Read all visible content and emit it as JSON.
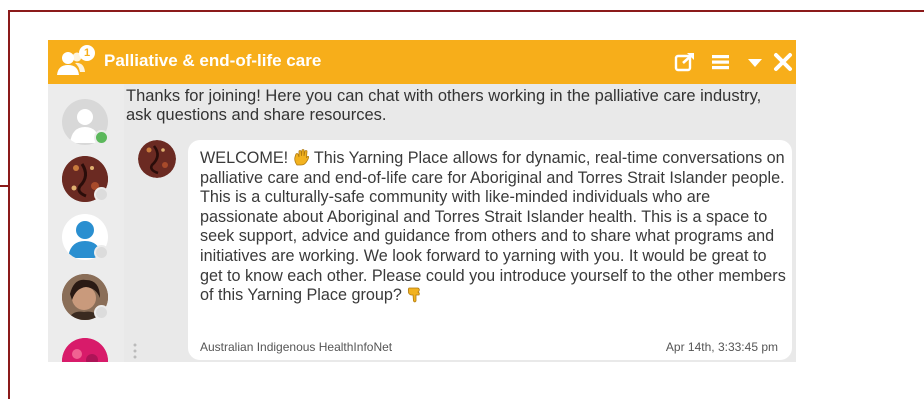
{
  "window": {
    "title": "Palliative & end-of-life care",
    "member_badge": "1",
    "accent_color": "#f7ae1a",
    "icons": [
      "users-icon",
      "popout-icon",
      "menu-icon",
      "collapse-icon",
      "close-icon"
    ]
  },
  "sidebar": {
    "members": [
      {
        "name": "member-placeholder-avatar",
        "status": "online"
      },
      {
        "name": "member-artwork-avatar",
        "status": "offline"
      },
      {
        "name": "member-default-avatar",
        "status": "offline"
      },
      {
        "name": "member-photo-avatar",
        "status": "offline"
      },
      {
        "name": "member-pink-avatar",
        "status": "offline"
      }
    ],
    "status_colors": {
      "online": "#5cb85c",
      "offline": "#dcdcdc"
    }
  },
  "intro": {
    "text": "Thanks for joining! Here you can chat with others working in the palliative care industry, ask questions and share resources."
  },
  "message": {
    "text_before_wave": "WELCOME! ",
    "text_main": " This Yarning Place allows for dynamic, real-time conversations on palliative care and end-of-life care for Aboriginal and Torres Strait Islander people. This is a culturally-safe community with like-minded individuals who are passionate about Aboriginal and Torres Strait Islander health. This is a space to seek support, advice and guidance from others and to share what programs and initiatives are working. We look forward to yarning with you. It would be great to get to know each other. Please could you introduce yourself to the other members of this Yarning Place group? ",
    "author": "Australian Indigenous HealthInfoNet",
    "timestamp": "Apr 14th, 3:33:45 pm",
    "emojis": [
      "waving-hand-icon",
      "pointing-down-hand-icon"
    ]
  }
}
